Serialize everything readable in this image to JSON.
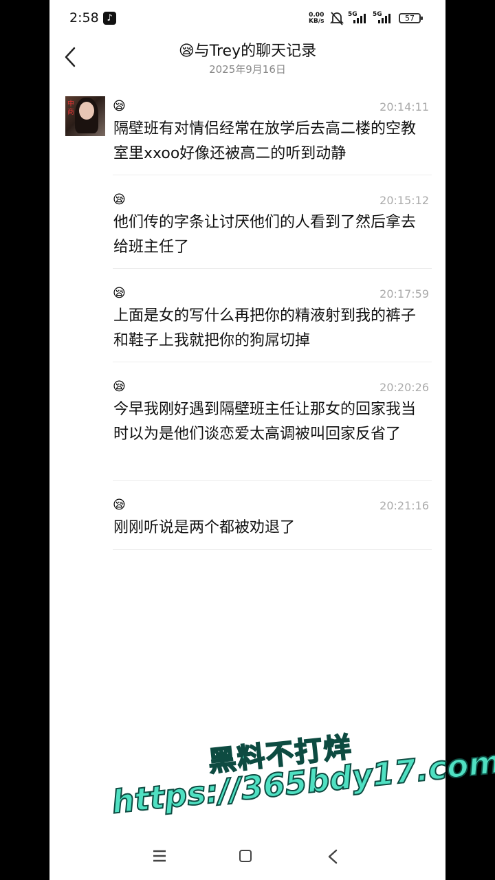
{
  "status_bar": {
    "time": "2:58",
    "app_icon": "tiktok-icon",
    "net_speed_value": "0.00",
    "net_speed_unit": "KB/s",
    "signal1_label": "5G",
    "signal2_label": "5G",
    "battery": "57"
  },
  "header": {
    "back_icon": "chevron-left-icon",
    "title": "😪与Trey的聊天记录",
    "date": "2025年9月16日"
  },
  "messages": [
    {
      "emoji": "😪",
      "time": "20:14:11",
      "text": "隔壁班有对情侣经常在放学后去高二楼的空教室里xxoo好像还被高二的听到动静"
    },
    {
      "emoji": "😪",
      "time": "20:15:12",
      "text": "他们传的字条让讨厌他们的人看到了然后拿去给班主任了"
    },
    {
      "emoji": "😪",
      "time": "20:17:59",
      "text": "上面是女的写什么再把你的精液射到我的裤子和鞋子上我就把你的狗屌切掉"
    },
    {
      "emoji": "😪",
      "time": "20:20:26",
      "text": "今早我刚好遇到隔壁班主任让那女的回家我当时以为是他们谈恋爱太高调被叫回家反省了"
    },
    {
      "emoji": "😪",
      "time": "20:21:16",
      "text": "刚刚听说是两个都被劝退了"
    }
  ],
  "watermark": {
    "line1": "黑料不打烊",
    "line2": "https://365bdy17.com",
    "color": "#4fe0c2"
  },
  "nav": {
    "menu_icon": "menu-icon",
    "home_icon": "home-icon",
    "back_icon": "back-icon"
  }
}
